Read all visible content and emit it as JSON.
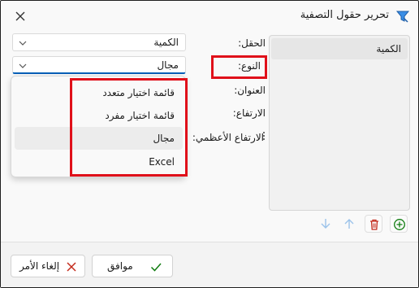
{
  "window": {
    "title": "تحرير حقول التصفية"
  },
  "list": {
    "items": [
      "الكمية"
    ]
  },
  "form": {
    "field_label": "الحقل:",
    "field_value": "الكمية",
    "type_label": "النوع:",
    "type_value": "مجال",
    "heading_label": "العنوان:",
    "height_label": "الارتفاع:",
    "max_height_label": "الارتفاع الأعظمي:"
  },
  "dropdown": {
    "options": [
      "قائمة اختيار متعدد",
      "قائمة اختيار مفرد",
      "مجال",
      "Excel"
    ],
    "hovered_index": 2
  },
  "footer": {
    "ok_label": "موافق",
    "cancel_label": "إلغاء الأمر"
  },
  "colors": {
    "accent": "#005fb8",
    "highlight": "#e0101a",
    "delete": "#c42b1c",
    "add": "#107c10",
    "ok_check": "#107c10",
    "cancel_x": "#c42b1c"
  }
}
